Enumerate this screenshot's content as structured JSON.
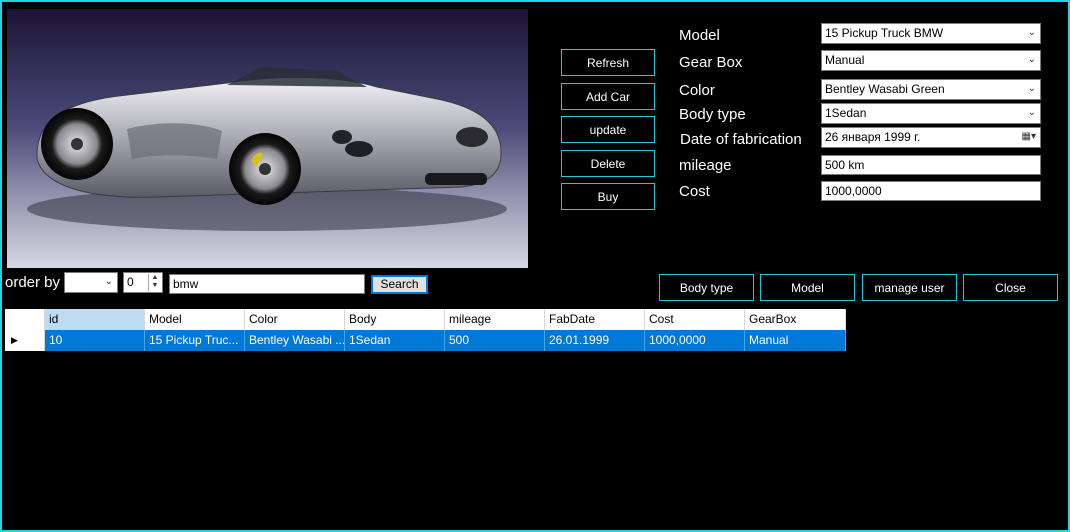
{
  "buttons": {
    "refresh": "Refresh",
    "add_car": "Add Car",
    "update": "update",
    "delete": "Delete",
    "buy": "Buy",
    "body_type": "Body type",
    "model": "Model",
    "manage_user": "manage user",
    "close": "Close",
    "search": "Search"
  },
  "form": {
    "model_label": "Model",
    "model_value": "15   Pickup Truck   BMW",
    "gearbox_label": "Gear Box",
    "gearbox_value": "Manual",
    "color_label": "Color",
    "color_value": "Bentley Wasabi Green",
    "bodytype_label": "Body type",
    "bodytype_value": "1Sedan",
    "date_label": "Date of fabrication",
    "date_value": "26   января   1999 г.",
    "mileage_label": "mileage",
    "mileage_value": "500 km",
    "cost_label": "Cost",
    "cost_value": "1000,0000"
  },
  "search_bar": {
    "order_by_label": "order by",
    "order_by_value": "",
    "numeric_value": "0",
    "search_text": "bmw"
  },
  "grid": {
    "columns": [
      "id",
      "Model",
      "Color",
      "Body",
      "mileage",
      "FabDate",
      "Cost",
      "GearBox"
    ],
    "rows": [
      [
        "10",
        "15   Pickup Truc...",
        "Bentley Wasabi ...",
        "1Sedan",
        "500",
        "26.01.1999",
        "1000,0000",
        "Manual"
      ]
    ]
  },
  "icons": {
    "dropdown": "chevron-down-icon",
    "calendar": "calendar-icon",
    "row_pointer": "row-pointer-icon",
    "spin": "spin-arrows-icon"
  },
  "colors": {
    "accent": "#22d3e6",
    "selection": "#0078d7",
    "background": "#000000"
  }
}
